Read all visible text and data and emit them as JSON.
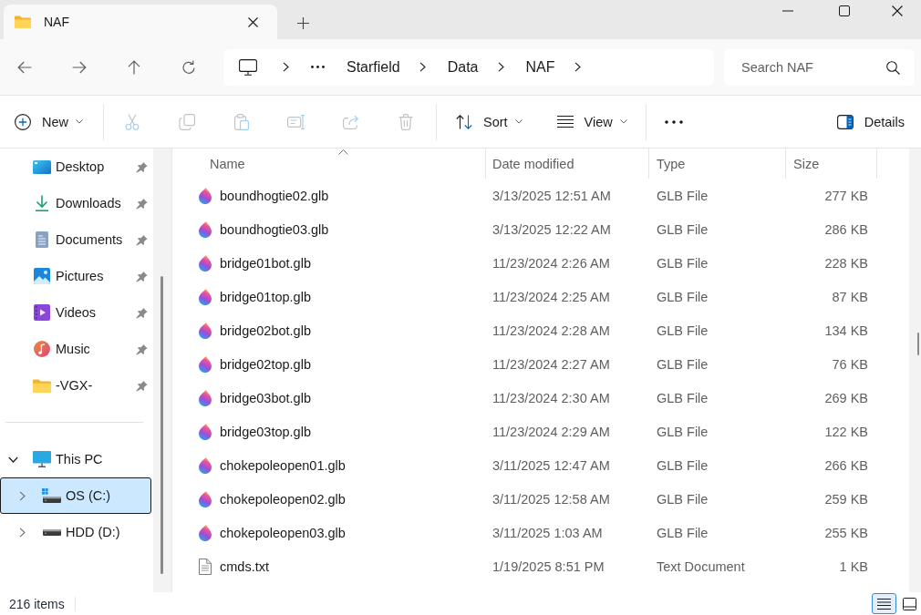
{
  "tabs": [
    {
      "title": "NAF",
      "selected": true
    }
  ],
  "address_bar": {
    "breadcrumbs": [
      "Starfield",
      "Data",
      "NAF"
    ]
  },
  "search": {
    "placeholder": "Search NAF"
  },
  "toolbar": {
    "new": {
      "label": "New"
    },
    "actions": [
      {
        "disabled": true
      },
      {
        "disabled": true
      },
      {
        "disabled": true
      },
      {
        "disabled": true
      },
      {
        "disabled": true
      },
      {
        "disabled": true
      }
    ],
    "sort": {
      "label": "Sort"
    },
    "view": {
      "label": "View"
    },
    "details": {
      "label": "Details"
    }
  },
  "sidebar": {
    "quick_access": [
      {
        "label": "Desktop",
        "pinned": true,
        "selected": false
      },
      {
        "label": "Downloads",
        "pinned": true,
        "selected": false
      },
      {
        "label": "Documents",
        "pinned": true,
        "selected": false
      },
      {
        "label": "Pictures",
        "pinned": true,
        "selected": false
      },
      {
        "label": "Videos",
        "pinned": true,
        "selected": false
      },
      {
        "label": "Music",
        "pinned": true,
        "selected": false
      },
      {
        "label": "-VGX-",
        "pinned": true,
        "selected": false
      }
    ],
    "this_pc": {
      "label": "This PC",
      "expanded": true,
      "selected": false,
      "children": [
        {
          "label": "OS (C:)",
          "expanded": false,
          "selected": true
        },
        {
          "label": "HDD (D:)",
          "expanded": false,
          "selected": false
        }
      ]
    }
  },
  "file_list": {
    "columns": [
      {
        "label": "Name",
        "sorted": true
      },
      {
        "label": "Date modified",
        "sorted": false
      },
      {
        "label": "Type",
        "sorted": false
      },
      {
        "label": "Size",
        "sorted": false
      }
    ],
    "rows": [
      {
        "kind": "glb",
        "name": "boundhogtie02.glb",
        "date_modified": "3/13/2025 12:51 AM",
        "type": "GLB File",
        "size": "277 KB",
        "selected": false
      },
      {
        "kind": "glb",
        "name": "boundhogtie03.glb",
        "date_modified": "3/13/2025 12:22 AM",
        "type": "GLB File",
        "size": "286 KB",
        "selected": false
      },
      {
        "kind": "glb",
        "name": "bridge01bot.glb",
        "date_modified": "11/23/2024 2:26 AM",
        "type": "GLB File",
        "size": "228 KB",
        "selected": false
      },
      {
        "kind": "glb",
        "name": "bridge01top.glb",
        "date_modified": "11/23/2024 2:25 AM",
        "type": "GLB File",
        "size": "87 KB",
        "selected": false
      },
      {
        "kind": "glb",
        "name": "bridge02bot.glb",
        "date_modified": "11/23/2024 2:28 AM",
        "type": "GLB File",
        "size": "134 KB",
        "selected": false
      },
      {
        "kind": "glb",
        "name": "bridge02top.glb",
        "date_modified": "11/23/2024 2:27 AM",
        "type": "GLB File",
        "size": "76 KB",
        "selected": false
      },
      {
        "kind": "glb",
        "name": "bridge03bot.glb",
        "date_modified": "11/23/2024 2:30 AM",
        "type": "GLB File",
        "size": "269 KB",
        "selected": false
      },
      {
        "kind": "glb",
        "name": "bridge03top.glb",
        "date_modified": "11/23/2024 2:29 AM",
        "type": "GLB File",
        "size": "122 KB",
        "selected": false
      },
      {
        "kind": "glb",
        "name": "chokepoleopen01.glb",
        "date_modified": "3/11/2025 12:47 AM",
        "type": "GLB File",
        "size": "266 KB",
        "selected": false
      },
      {
        "kind": "glb",
        "name": "chokepoleopen02.glb",
        "date_modified": "3/11/2025 12:58 AM",
        "type": "GLB File",
        "size": "259 KB",
        "selected": false
      },
      {
        "kind": "glb",
        "name": "chokepoleopen03.glb",
        "date_modified": "3/11/2025 1:03 AM",
        "type": "GLB File",
        "size": "255 KB",
        "selected": false
      },
      {
        "kind": "txt",
        "name": "cmds.txt",
        "date_modified": "1/19/2025 8:51 PM",
        "type": "Text Document",
        "size": "1 KB",
        "selected": false
      }
    ]
  },
  "status_bar": {
    "item_count": "216 items",
    "views": [
      {
        "selected": true
      },
      {
        "selected": false
      }
    ]
  }
}
